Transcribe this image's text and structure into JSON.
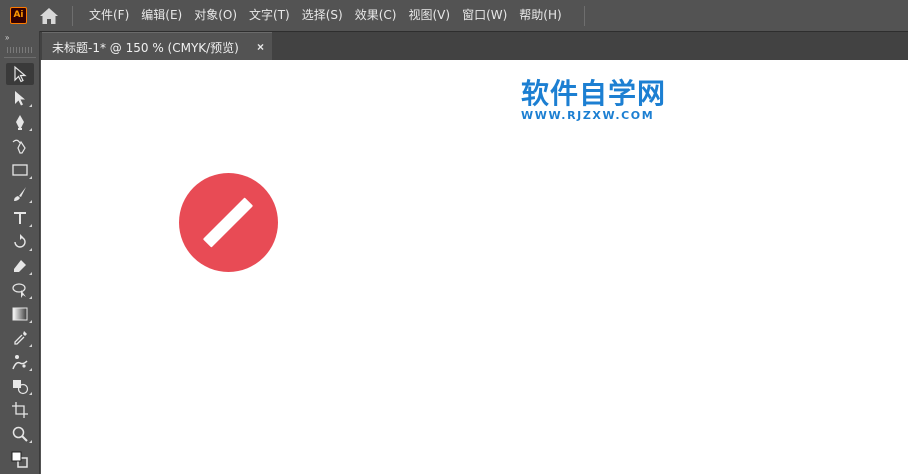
{
  "app": {
    "logo_text": "Ai",
    "logo_color": "#ff9a00"
  },
  "menu": {
    "items": [
      {
        "label": "文件(F)"
      },
      {
        "label": "编辑(E)"
      },
      {
        "label": "对象(O)"
      },
      {
        "label": "文字(T)"
      },
      {
        "label": "选择(S)"
      },
      {
        "label": "效果(C)"
      },
      {
        "label": "视图(V)"
      },
      {
        "label": "窗口(W)"
      },
      {
        "label": "帮助(H)"
      }
    ]
  },
  "panel_collapse": "››",
  "document_tab": {
    "title": "未标题-1* @ 150 % (CMYK/预览)",
    "close": "×"
  },
  "toolbar": {
    "tools": [
      {
        "name": "selection-tool",
        "active": true
      },
      {
        "name": "direct-selection-tool"
      },
      {
        "name": "pen-tool"
      },
      {
        "name": "curvature-tool"
      },
      {
        "name": "rectangle-tool"
      },
      {
        "name": "paintbrush-tool"
      },
      {
        "name": "type-tool"
      },
      {
        "name": "rotate-tool"
      },
      {
        "name": "eraser-tool"
      },
      {
        "name": "lasso-select-tool"
      },
      {
        "name": "gradient-tool"
      },
      {
        "name": "eyedropper-tool"
      },
      {
        "name": "puppet-warp-tool"
      },
      {
        "name": "shape-builder-tool"
      },
      {
        "name": "artboard-tool"
      },
      {
        "name": "zoom-tool"
      },
      {
        "name": "fill-stroke-swatches"
      }
    ]
  },
  "watermark": {
    "title": "软件自学网",
    "url": "WWW.RJZXW.COM",
    "color": "#1c7fd2"
  },
  "artwork": {
    "circle_color": "#e84b55",
    "bar_color": "#ffffff"
  }
}
